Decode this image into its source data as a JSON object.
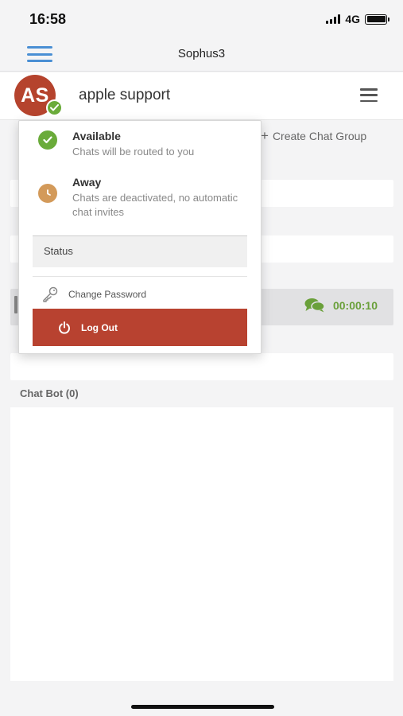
{
  "status_bar": {
    "time": "16:58",
    "network": "4G"
  },
  "navbar": {
    "title": "Sophus3"
  },
  "header": {
    "avatar_initials": "AS",
    "user_name": "apple support"
  },
  "toolbar": {
    "create_group_label": "Create Chat Group"
  },
  "active_chat": {
    "timer": "00:00:10"
  },
  "chatbot": {
    "label": "Chat Bot (0)"
  },
  "dropdown": {
    "available": {
      "title": "Available",
      "description": "Chats will be routed to you",
      "color": "#6aab3a"
    },
    "away": {
      "title": "Away",
      "description": "Chats are deactivated, no automatic chat invites",
      "color": "#d39a5a"
    },
    "status_label": "Status",
    "change_password_label": "Change Password",
    "logout_label": "Log Out"
  },
  "colors": {
    "accent": "#4a8fd4",
    "danger": "#b84230",
    "success": "#6aab3a",
    "avatar": "#b5432d"
  }
}
